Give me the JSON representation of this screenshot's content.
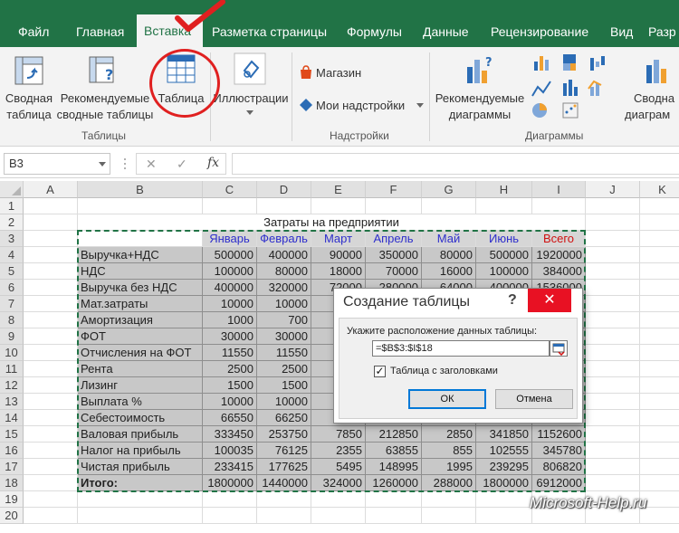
{
  "ribbon_tabs": [
    "Файл",
    "Главная",
    "Вставка",
    "Разметка страницы",
    "Формулы",
    "Данные",
    "Рецензирование",
    "Вид",
    "Разр"
  ],
  "active_tab": "Вставка",
  "ribbon": {
    "pivot_table": [
      "Сводная",
      "таблица"
    ],
    "recommended_pivot": [
      "Рекомендуемые",
      "сводные таблицы"
    ],
    "table": "Таблица",
    "illustrations": "Иллюстрации",
    "store": "Магазин",
    "my_addins": "Мои надстройки",
    "recommended_charts": [
      "Рекомендуемые",
      "диаграммы"
    ],
    "pivot_chart": [
      "Сводна",
      "диаграм"
    ],
    "groups": {
      "tables": "Таблицы",
      "addins": "Надстройки",
      "charts": "Диаграммы"
    }
  },
  "formula_bar": {
    "name_box": "B3",
    "cancel": "✕",
    "enter": "✓",
    "fx": "fx",
    "formula": ""
  },
  "grid": {
    "columns": [
      "A",
      "B",
      "C",
      "D",
      "E",
      "F",
      "G",
      "H",
      "I",
      "J",
      "K"
    ],
    "rows": [
      "1",
      "2",
      "3",
      "4",
      "5",
      "6",
      "7",
      "8",
      "9",
      "10",
      "11",
      "12",
      "13",
      "14",
      "15",
      "16",
      "17",
      "18",
      "19",
      "20"
    ],
    "title": "Затраты на предприятии",
    "headers": [
      "Январь",
      "Февраль",
      "Март",
      "Апрель",
      "Май",
      "Июнь",
      "Всего"
    ],
    "data_rows": [
      {
        "label": "Выручка+НДС",
        "values": [
          "500000",
          "400000",
          "90000",
          "350000",
          "80000",
          "500000",
          "1920000"
        ]
      },
      {
        "label": "НДС",
        "values": [
          "100000",
          "80000",
          "18000",
          "70000",
          "16000",
          "100000",
          "384000"
        ]
      },
      {
        "label": "Выручка без НДС",
        "values": [
          "400000",
          "320000",
          "72000",
          "280000",
          "64000",
          "400000",
          "1536000"
        ]
      },
      {
        "label": "Мат.затраты",
        "values": [
          "10000",
          "10000",
          "",
          "",
          "",
          "",
          ""
        ]
      },
      {
        "label": "Амортизация",
        "values": [
          "1000",
          "700",
          "",
          "",
          "",
          "",
          ""
        ]
      },
      {
        "label": "ФОТ",
        "values": [
          "30000",
          "30000",
          "",
          "",
          "",
          "",
          ""
        ]
      },
      {
        "label": "Отчисления на ФОТ",
        "values": [
          "11550",
          "11550",
          "",
          "",
          "",
          "",
          ""
        ]
      },
      {
        "label": "Рента",
        "values": [
          "2500",
          "2500",
          "",
          "",
          "",
          "",
          ""
        ]
      },
      {
        "label": "Лизинг",
        "values": [
          "1500",
          "1500",
          "",
          "",
          "",
          "",
          ""
        ]
      },
      {
        "label": "Выплата %",
        "values": [
          "10000",
          "10000",
          "",
          "",
          "",
          "",
          ""
        ]
      },
      {
        "label": "Себестоимость",
        "values": [
          "66550",
          "66250",
          "",
          "",
          "",
          "",
          ""
        ]
      },
      {
        "label": "Валовая прибыль",
        "values": [
          "333450",
          "253750",
          "7850",
          "212850",
          "2850",
          "341850",
          "1152600"
        ]
      },
      {
        "label": "Налог на прибыль",
        "values": [
          "100035",
          "76125",
          "2355",
          "63855",
          "855",
          "102555",
          "345780"
        ]
      },
      {
        "label": "Чистая прибыль",
        "values": [
          "233415",
          "177625",
          "5495",
          "148995",
          "1995",
          "239295",
          "806820"
        ]
      },
      {
        "label": "Итого:",
        "values": [
          "1800000",
          "1440000",
          "324000",
          "1260000",
          "288000",
          "1800000",
          "6912000"
        ]
      }
    ]
  },
  "dialog": {
    "title": "Создание таблицы",
    "help": "?",
    "close": "✕",
    "prompt": "Укажите расположение данных таблицы:",
    "range": "=$B$3:$I$18",
    "checkbox_label": "Таблица с заголовками",
    "checked_mark": "✓",
    "ok": "ОК",
    "cancel": "Отмена"
  },
  "watermark": "Microsoft-Help.ru",
  "colors": {
    "excel_green": "#217346",
    "header_blue": "#2e2ecc",
    "total_red": "#d01010",
    "close_red": "#e81123"
  }
}
